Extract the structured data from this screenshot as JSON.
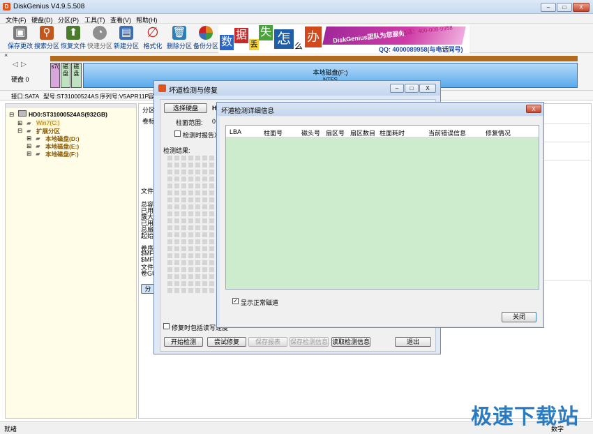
{
  "app": {
    "title": "DiskGenius V4.9.5.508",
    "logo_letter": "D"
  },
  "window_controls": {
    "minimize": "–",
    "maximize": "□",
    "close": "X"
  },
  "menu": [
    "文件(F)",
    "硬盘(D)",
    "分区(P)",
    "工具(T)",
    "查看(V)",
    "帮助(H)"
  ],
  "toolbar": [
    {
      "label": "保存更改",
      "icon": "save-icon",
      "color": "#7a7a7a"
    },
    {
      "label": "搜索分区",
      "icon": "search-icon",
      "color": "#c2571d"
    },
    {
      "label": "恢复文件",
      "icon": "recover-icon",
      "color": "#4b7c2b"
    },
    {
      "label": "快速分区",
      "icon": "quick-partition-icon",
      "color": "#8f8f8f"
    },
    {
      "label": "新建分区",
      "icon": "new-partition-icon",
      "color": "#3d6db5"
    },
    {
      "label": "格式化",
      "icon": "format-icon",
      "color": "#c22"
    },
    {
      "label": "删除分区",
      "icon": "delete-icon",
      "color": "#2e7fb4"
    },
    {
      "label": "备份分区",
      "icon": "backup-icon",
      "color": "#d98a1c"
    }
  ],
  "banner": {
    "chars": [
      "数",
      "据",
      "丢",
      "失",
      "怎",
      "么",
      "办"
    ],
    "brand": "DiskGenius团队为您服务",
    "phone": "电话：400-008-9958",
    "qq": "QQ: 4000089958(与电话同号)"
  },
  "diskbar": {
    "disk_label": "硬盘 0",
    "parts": [
      "Win7(C:) NTFS",
      "本地磁盘(D:)",
      "本地磁盘(E:)"
    ],
    "part_abbr": [
      "s7(",
      "磁盘",
      "磁盘"
    ],
    "main_partition": {
      "name": "本地磁盘(F:)",
      "fs": "NTFS"
    }
  },
  "infobar": {
    "interface": "接口:SATA",
    "model": "型号:ST31000524AS",
    "serial": "序列号:V5APR11P",
    "more": "容"
  },
  "tree": {
    "disk": "HD0:ST31000524AS(932GB)",
    "items": [
      "Win7(C:)",
      "扩展分区",
      "本地磁盘(D:)",
      "本地磁盘(E:)",
      "本地磁盘(F:)"
    ]
  },
  "right_pane": {
    "tab_partition": "分区",
    "volume_label": "卷标",
    "file_system": "文件",
    "details": [
      "总容",
      "已用",
      "簇大",
      "已用",
      "总扇",
      "起始"
    ],
    "details2": [
      "卷序",
      "$MFT",
      "$MFT",
      "文件",
      "卷GU"
    ],
    "button": "分"
  },
  "dlg_repair": {
    "title": "坏道检测与修复",
    "select_disk": "选择硬盘",
    "disk_prefix": "HD0",
    "cyl_range_label": "柱面范围:",
    "cyl_from": "0",
    "report_check": "检测时报告准",
    "result_label": "检测结果:",
    "write_check": "修复时包括读写速度",
    "btn_start": "开始检测",
    "btn_try_repair": "尝试修复",
    "btn_save_report": "保存报表",
    "btn_save_info": "保存检测信息",
    "btn_read_info": "读取检测信息",
    "btn_exit": "退出"
  },
  "dlg_detail": {
    "title": "坏道检测详细信息",
    "columns": [
      "LBA",
      "柱面号",
      "磁头号",
      "扇区号",
      "扇区数目",
      "柱面耗时",
      "当前错误信息",
      "修复情况"
    ],
    "show_normal": "显示正常磁道",
    "show_normal_checked": true,
    "btn_close": "关闭"
  },
  "status": {
    "left": "就绪",
    "right": "数字"
  },
  "watermark": "极速下载站"
}
